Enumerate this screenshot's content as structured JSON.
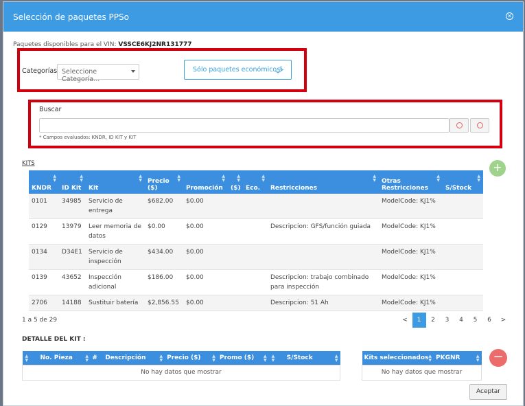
{
  "dialog": {
    "title": "Selección de paquetes PPSo",
    "close_icon": "close-icon"
  },
  "vin": {
    "label": "Paquetes disponibles para el VIN:",
    "value": "VSSCE6KJ2NR131777"
  },
  "filters": {
    "categories_label": "Categorías",
    "categories_select": "Seleccione Categoría...",
    "eco_button": "Sólo paquetes económicos"
  },
  "search": {
    "label": "Buscar",
    "value": "",
    "hint": "* Campos evaluados: KNDR, ID KIT y KIT"
  },
  "kits": {
    "label": "KITS",
    "columns": [
      "KNDR",
      "ID Kit",
      "Kit",
      "Precio ($)",
      "Promoción",
      "($)",
      "Eco.",
      "Restricciones",
      "Otras Restricciones",
      "S/Stock"
    ],
    "rows": [
      {
        "kndr": "0101",
        "id": "34985",
        "kit": "Servicio de entrega",
        "precio": "$682.00",
        "promo": "$0.00",
        "restr": "",
        "otras": "ModelCode: KJ1%"
      },
      {
        "kndr": "0129",
        "id": "13979",
        "kit": "Leer memoria de datos",
        "precio": "$0.00",
        "promo": "$0.00",
        "restr": "Descripcion: GFS/función guiada",
        "otras": "ModelCode: KJ1%"
      },
      {
        "kndr": "0134",
        "id": "D34E1",
        "kit": "Servicio de inspección",
        "precio": "$434.00",
        "promo": "$0.00",
        "restr": "",
        "otras": "ModelCode: KJ1%"
      },
      {
        "kndr": "0139",
        "id": "43652",
        "kit": "Inspección adicional",
        "precio": "$186.00",
        "promo": "$0.00",
        "restr": "Descripcion: trabajo combinado para inspección",
        "otras": "ModelCode: KJ1%"
      },
      {
        "kndr": "2706",
        "id": "14188",
        "kit": "Sustituir batería",
        "precio": "$2,856.55",
        "promo": "$0.00",
        "restr": "Descripcion: 51 Ah",
        "otras": "ModelCode: KJ1%"
      }
    ],
    "count_text": "1 a 5 de 29",
    "pagination": [
      "<",
      "1",
      "2",
      "3",
      "4",
      "5",
      "6",
      ">"
    ],
    "active_page": "1"
  },
  "detail": {
    "label": "DETALLE DEL KIT :",
    "columns": [
      "No. Pieza",
      "#",
      "Descripción",
      "Precio ($)",
      "Promo ($)",
      "S/Stock"
    ],
    "empty": "No hay datos que mostrar"
  },
  "selected": {
    "columns": [
      "Kits seleccionados",
      "PKGNR"
    ],
    "empty": "No hay datos que mostrar"
  },
  "accept_button": "Aceptar",
  "colors": {
    "header": "#3c9be2",
    "highlight": "#d2000f",
    "add": "#9fd28a",
    "remove": "#ec6b6b"
  }
}
